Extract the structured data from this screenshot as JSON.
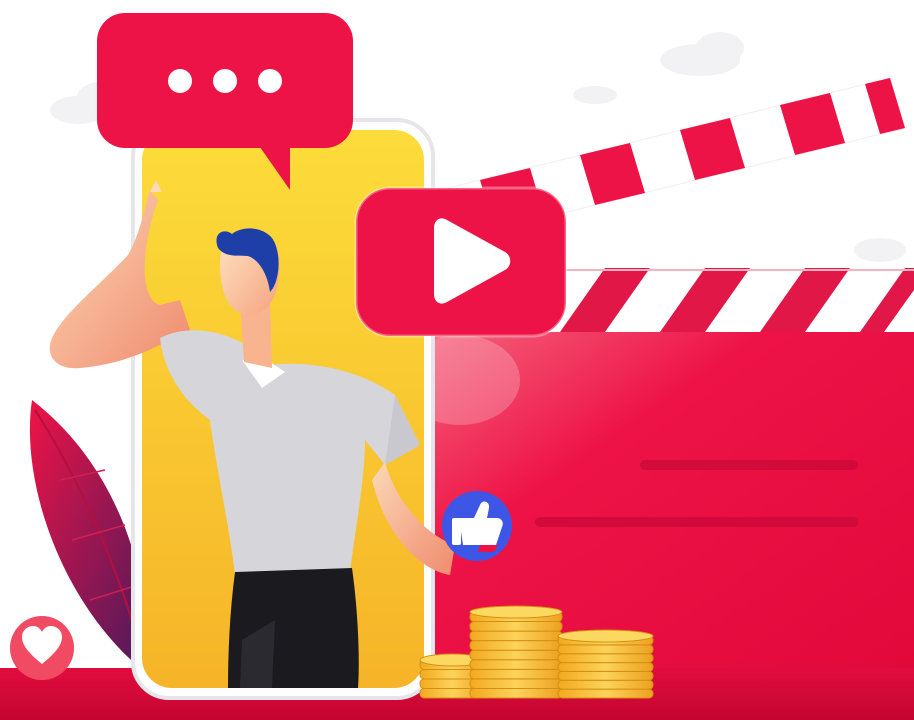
{
  "illustration": {
    "subject": "video-monetization",
    "icons": {
      "chat_bubble": "chat-bubble-icon",
      "play_button": "play-icon",
      "thumbs_up": "thumbs-up-icon",
      "heart": "heart-icon",
      "coins": "coin-stack-icon"
    },
    "colors": {
      "brand_red": "#EE1346",
      "phone_yellow": "#FBCB2D",
      "badge_blue": "#3E56E6",
      "shirt_gray": "#D6D6DA",
      "hair_blue": "#1E3FA8",
      "coin_gold": "#F6BF3A"
    }
  }
}
